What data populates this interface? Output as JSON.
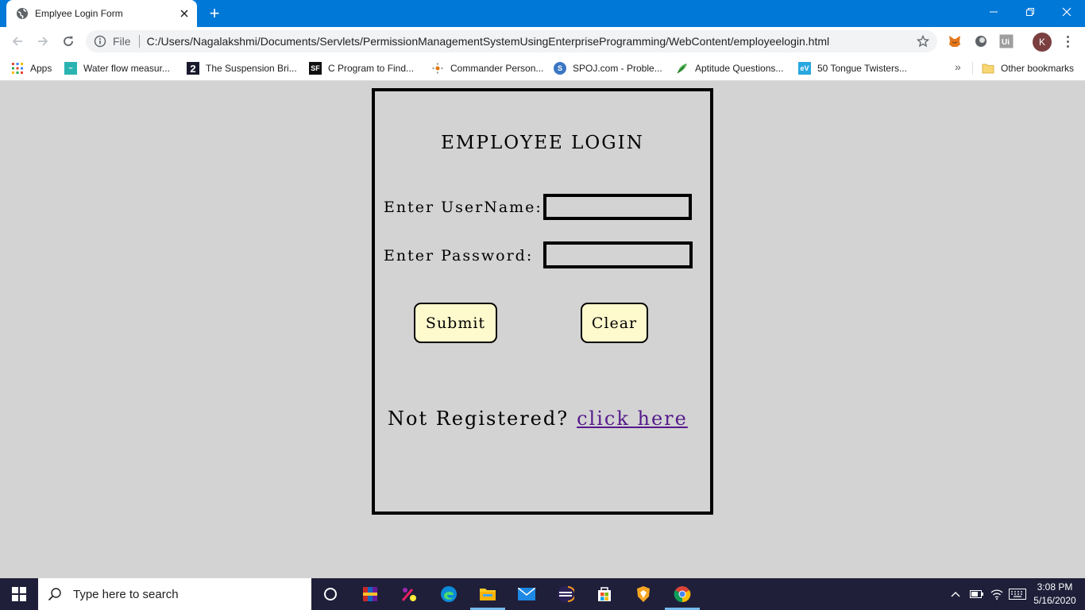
{
  "browser": {
    "tab_title": "Emplyee Login Form",
    "new_tab_symbol": "+",
    "address_scheme_label": "File",
    "url": "C:/Users/Nagalakshmi/Documents/Servlets/PermissionManagementSystemUsingEnterpriseProgramming/WebContent/employeelogin.html",
    "profile_initial": "K",
    "bookmarks": [
      {
        "label": "Apps",
        "icon": "apps-grid-icon"
      },
      {
        "label": "Water flow measur...",
        "icon": "water-flow-icon"
      },
      {
        "label": "The Suspension Bri...",
        "icon": "number-2-icon"
      },
      {
        "label": "C Program to Find...",
        "icon": "sf-icon"
      },
      {
        "label": "Commander Person...",
        "icon": "gear-dots-icon"
      },
      {
        "label": "SPOJ.com - Proble...",
        "icon": "spoj-icon"
      },
      {
        "label": "Aptitude Questions...",
        "icon": "leaf-icon"
      },
      {
        "label": "50 Tongue Twisters...",
        "icon": "ev-icon"
      }
    ],
    "bookmarks_overflow": "»",
    "other_bookmarks": "Other bookmarks"
  },
  "page": {
    "title": "EMPLOYEE LOGIN",
    "username_label": "Enter UserName:",
    "password_label": "Enter Password:",
    "username_value": "",
    "password_value": "",
    "submit_label": "Submit",
    "clear_label": "Clear",
    "register_prompt": "Not Registered?",
    "register_link": "click here",
    "colors": {
      "background": "#d3d3d3",
      "button_fill": "#fffacd",
      "link": "#551a8b"
    }
  },
  "taskbar": {
    "search_placeholder": "Type here to search",
    "time": "3:08 PM",
    "date": "5/16/2020",
    "apps": [
      "cortana-icon",
      "winrar-icon",
      "paint-icon",
      "edge-icon",
      "file-explorer-icon",
      "mail-icon",
      "eclipse-icon",
      "store-icon",
      "brave-icon",
      "chrome-icon"
    ]
  }
}
